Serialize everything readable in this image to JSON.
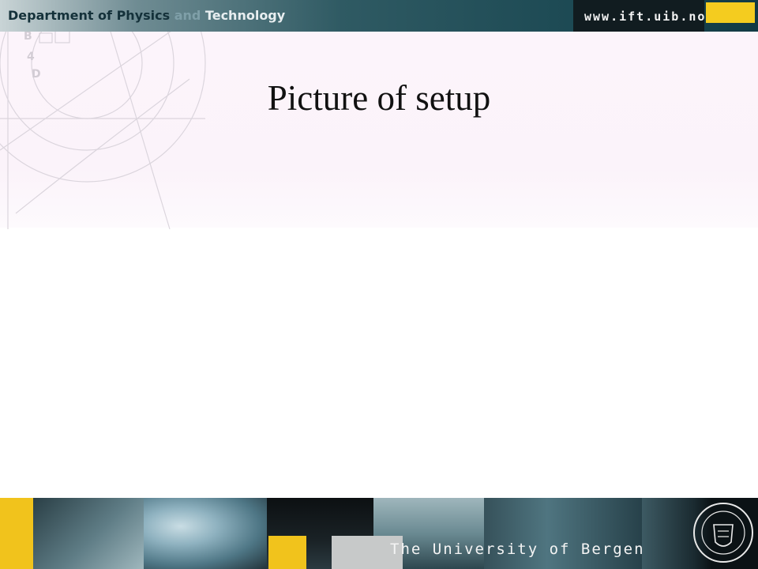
{
  "header": {
    "title_part1": "Department of Physics ",
    "title_part2": "and",
    "title_part3": " Technology",
    "url": "www.ift.uib.no"
  },
  "slide": {
    "title": "Picture of setup"
  },
  "footer": {
    "university": "The University of Bergen"
  },
  "colors": {
    "header_dark": "#123a44",
    "accent_yellow": "#f4cc1f",
    "content_background": "#fbf3fa"
  }
}
